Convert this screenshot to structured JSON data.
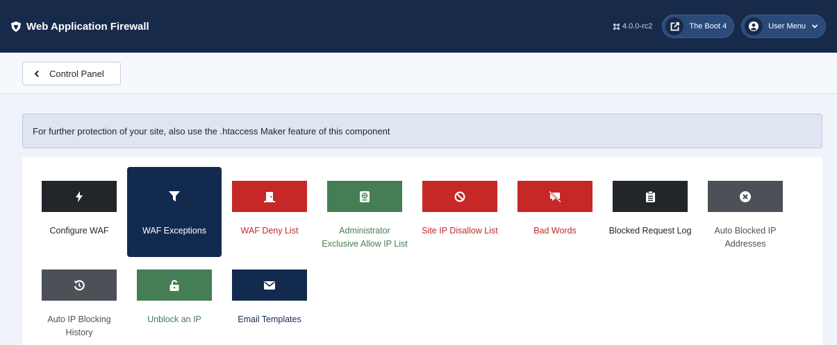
{
  "header": {
    "title": "Web Application Firewall",
    "version": "4.0.0-rc2",
    "site_button": "The Boot 4",
    "user_menu": "User Menu"
  },
  "toolbar": {
    "back_label": "Control Panel"
  },
  "alert": {
    "text": "For further protection of your site, also use the .htaccess Maker feature of this component"
  },
  "colors": {
    "header_bg": "#182a4a",
    "dark": "#22262a",
    "navy": "#132a4f",
    "red": "#c52827",
    "green": "#457d54",
    "gray": "#4c5057"
  },
  "tiles": [
    {
      "label": "Configure WAF",
      "icon": "bolt-icon",
      "color": "#22262a",
      "text_color": "#22262a",
      "active": false
    },
    {
      "label": "WAF Exceptions",
      "icon": "filter-icon",
      "color": "#132a4f",
      "text_color": "#ffffff",
      "active": true
    },
    {
      "label": "WAF Deny List",
      "icon": "door-icon",
      "color": "#c52827",
      "text_color": "#c52827",
      "active": false
    },
    {
      "label": "Administrator Exclusive Allow IP List",
      "icon": "passport-icon",
      "color": "#457d54",
      "text_color": "#457d54",
      "active": false
    },
    {
      "label": "Site IP Disallow List",
      "icon": "ban-icon",
      "color": "#c52827",
      "text_color": "#c52827",
      "active": false
    },
    {
      "label": "Bad Words",
      "icon": "comment-slash-icon",
      "color": "#c52827",
      "text_color": "#c52827",
      "active": false
    },
    {
      "label": "Blocked Request Log",
      "icon": "clipboard-list-icon",
      "color": "#22262a",
      "text_color": "#22262a",
      "active": false
    },
    {
      "label": "Auto Blocked IP Addresses",
      "icon": "times-circle-icon",
      "color": "#4c5057",
      "text_color": "#4c5057",
      "active": false
    },
    {
      "label": "Auto IP Blocking History",
      "icon": "history-icon",
      "color": "#4c5057",
      "text_color": "#4c5057",
      "active": false
    },
    {
      "label": "Unblock an IP",
      "icon": "unlock-icon",
      "color": "#457d54",
      "text_color": "#457d54",
      "active": false
    },
    {
      "label": "Email Templates",
      "icon": "envelope-icon",
      "color": "#132a4f",
      "text_color": "#132a4f",
      "active": false
    }
  ]
}
